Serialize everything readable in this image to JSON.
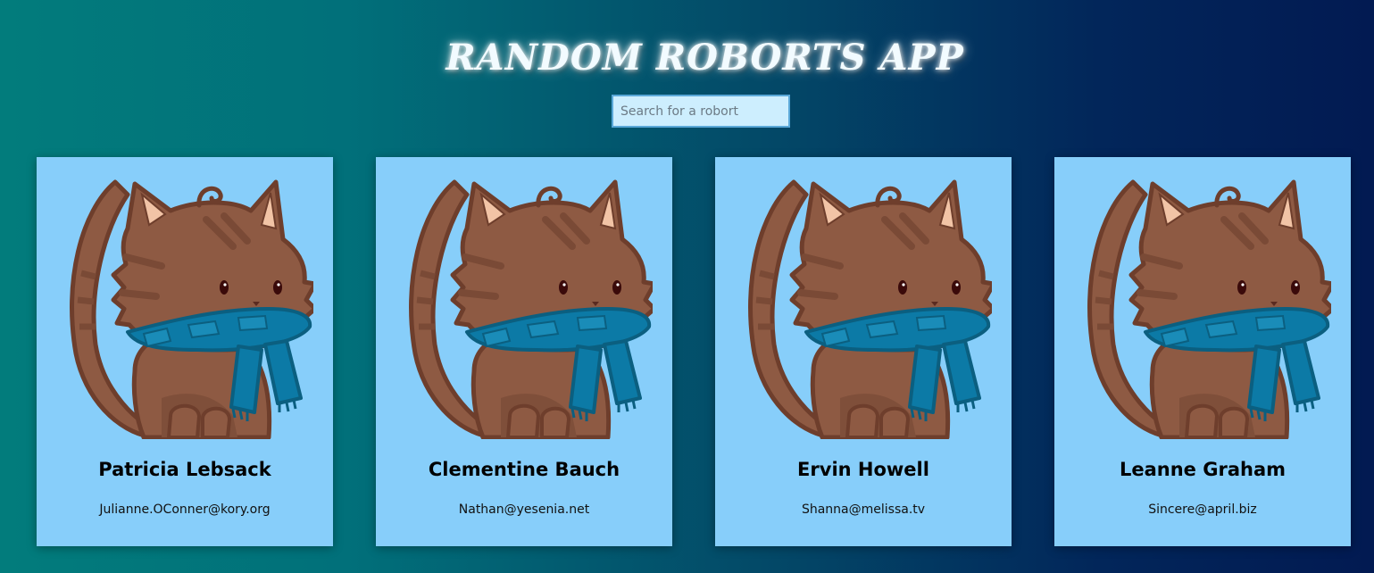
{
  "app": {
    "title": "RANDOM ROBORTS APP"
  },
  "search": {
    "placeholder": "Search for a robort",
    "value": ""
  },
  "cards": [
    {
      "name": "Patricia Lebsack",
      "email": "Julianne.OConner@kory.org",
      "avatar_icon": "cat-with-scarf-icon"
    },
    {
      "name": "Clementine Bauch",
      "email": "Nathan@yesenia.net",
      "avatar_icon": "cat-with-scarf-icon"
    },
    {
      "name": "Ervin Howell",
      "email": "Shanna@melissa.tv",
      "avatar_icon": "cat-with-scarf-icon"
    },
    {
      "name": "Leanne Graham",
      "email": "Sincere@april.biz",
      "avatar_icon": "cat-with-scarf-icon"
    }
  ],
  "colors": {
    "card_background": "#87cefa",
    "cat_fur": "#8e5a43",
    "cat_outline": "#6e3e2c",
    "scarf": "#0c7aa6"
  }
}
